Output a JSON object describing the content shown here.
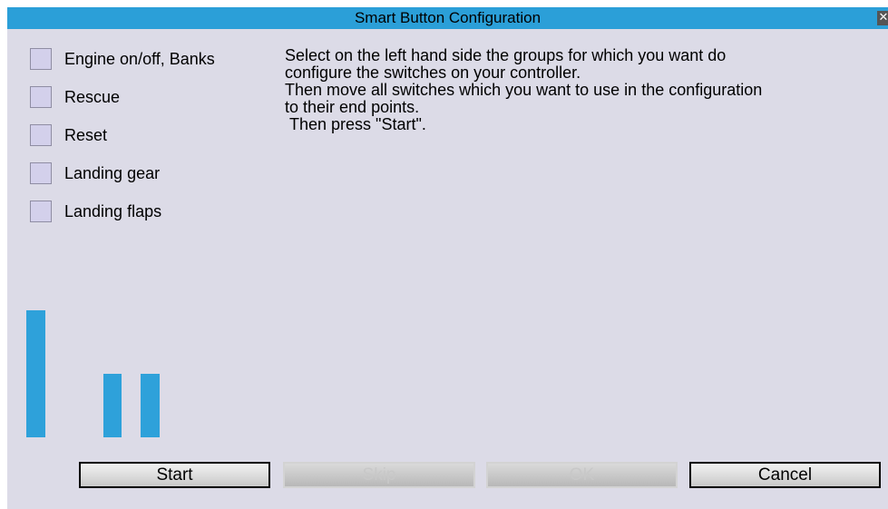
{
  "window": {
    "title": "Smart Button Configuration",
    "close_glyph": "✕"
  },
  "groups": [
    {
      "label": "Engine on/off, Banks",
      "checked": false
    },
    {
      "label": "Rescue",
      "checked": false
    },
    {
      "label": "Reset",
      "checked": false
    },
    {
      "label": "Landing gear",
      "checked": false
    },
    {
      "label": "Landing flaps",
      "checked": false
    }
  ],
  "instructions": "Select on the left hand side the groups for which you want do\nconfigure the switches on your controller.\nThen move all switches which you want to use in the configuration\nto their end points.\n Then press \"Start\".",
  "meters": [
    {
      "level": 1.0
    },
    {
      "level": 0.5
    },
    {
      "level": 0.5
    }
  ],
  "buttons": {
    "start": "Start",
    "skip": "Skip",
    "ok": "OK",
    "cancel": "Cancel"
  },
  "colors": {
    "titlebar": "#2b9fd8",
    "client_background": "#dcdbe7",
    "meter": "#2ea1da"
  }
}
